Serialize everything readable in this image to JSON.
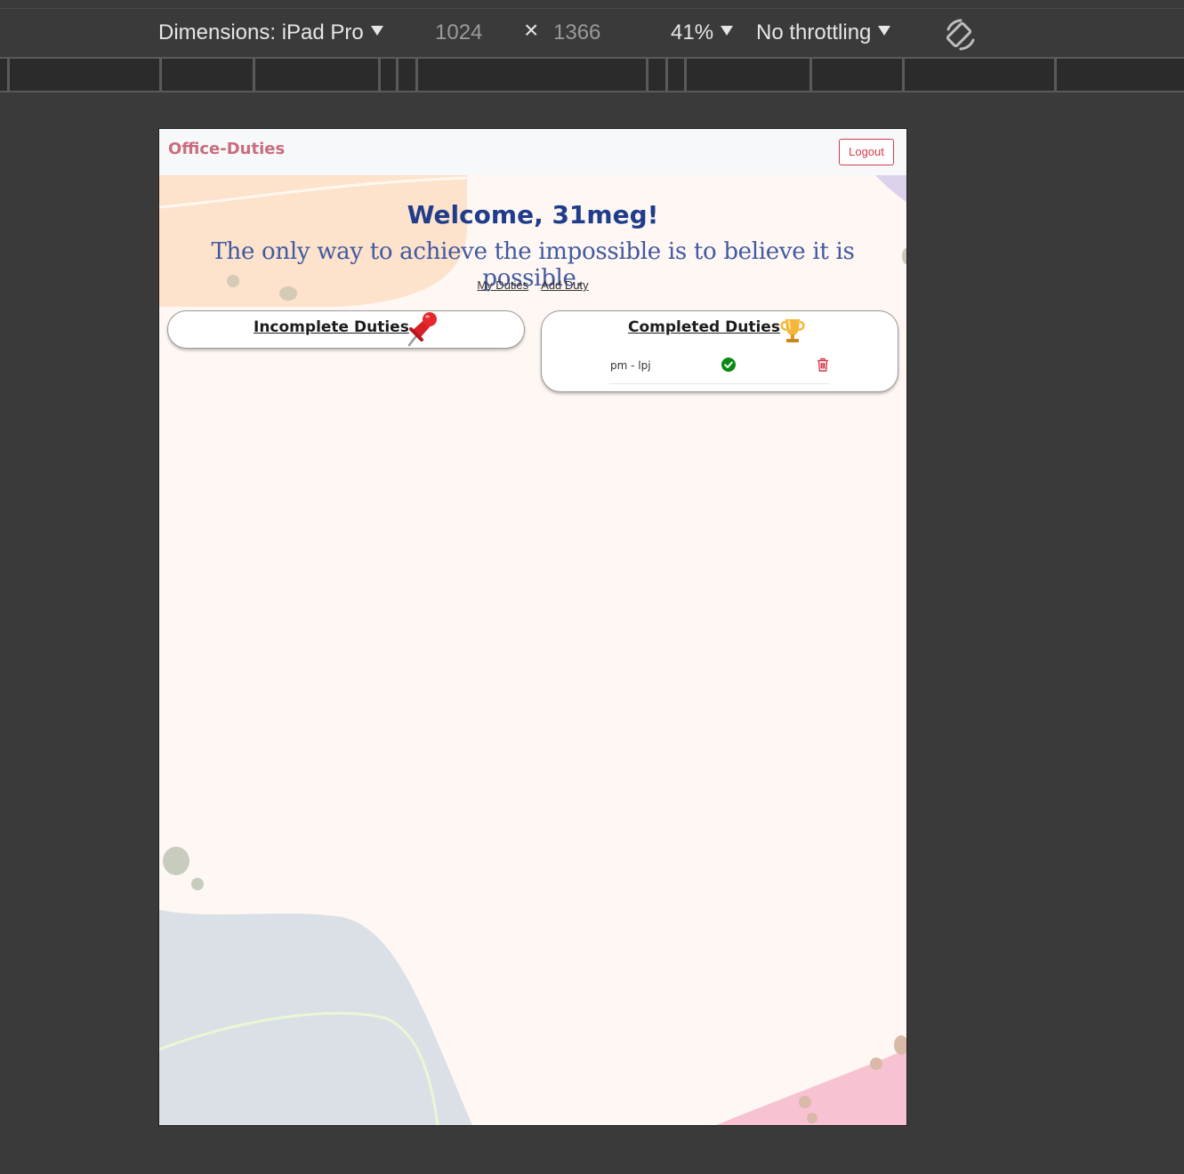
{
  "devtools": {
    "dimensions_label": "Dimensions: iPad Pro",
    "width": "1024",
    "times": "×",
    "height": "1366",
    "zoom": "41%",
    "throttling": "No throttling"
  },
  "app": {
    "brand": "Office-Duties",
    "logout_label": "Logout",
    "welcome": "Welcome, 31meg!",
    "quote": "The only way to achieve the impossible is to believe it is possible.",
    "nav": {
      "my_duties": "My Duties",
      "add_duty": "Add Duty"
    },
    "incomplete": {
      "title": "Incomplete Duties",
      "icon": "pushpin-icon",
      "items": []
    },
    "completed": {
      "title": "Completed Duties",
      "icon": "trophy-icon",
      "items": [
        {
          "text": "pm - lpj",
          "status_icon": "check-circle-icon",
          "action_icon": "trash-icon"
        }
      ]
    },
    "colors": {
      "brand": "#c86d7e",
      "welcome": "#1f3d8a",
      "quote": "#4059a0",
      "logout": "#d33b4a",
      "check": "#0a8a14",
      "trash": "#d33b4a",
      "background": "#fff7f4"
    }
  }
}
